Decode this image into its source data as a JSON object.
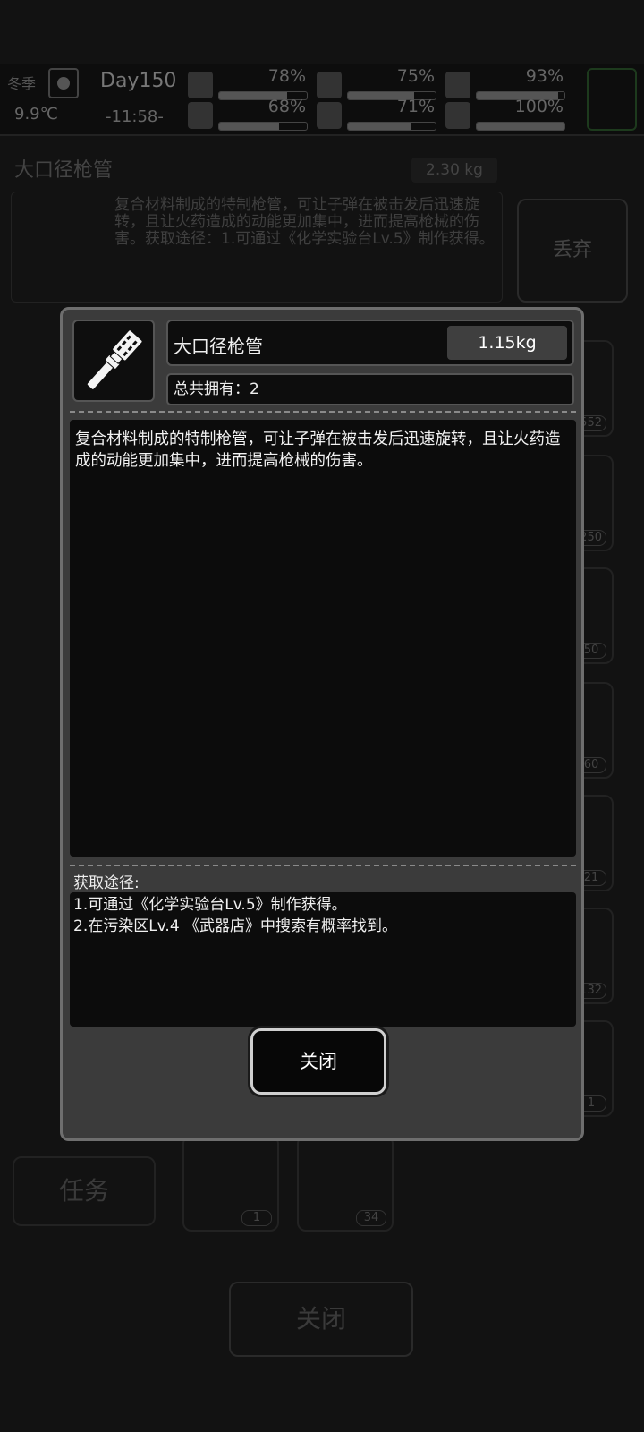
{
  "status": {
    "season": "冬季",
    "temperature": "9.9℃",
    "day": "Day150",
    "time": "-11:58-",
    "stats": [
      {
        "icon": "medkit-icon",
        "value": "78%",
        "fill": 0.78
      },
      {
        "icon": "stomach-icon",
        "value": "75%",
        "fill": 0.75
      },
      {
        "icon": "pill-icon",
        "value": "93%",
        "fill": 0.93
      },
      {
        "icon": "boot-icon",
        "value": "68%",
        "fill": 0.68
      },
      {
        "icon": "water-drop-icon",
        "value": "71%",
        "fill": 0.71
      },
      {
        "icon": "heart-icon",
        "value": "100%",
        "fill": 1.0
      }
    ]
  },
  "background": {
    "item_title": "大口径枪管",
    "item_weight": "2.30 kg",
    "item_desc": "复合材料制成的特制枪管，可让子弹在被击发后迅速旋转，且让火药造成的动能更加集中，进而提高枪械的伤害。获取途径：1.可通过《化学实验台Lv.5》制作获得。",
    "discard_label": "丢弃",
    "task_label": "任务",
    "close_label": "关闭",
    "slot_counts": [
      "552",
      "250",
      "50",
      "60",
      "21",
      "132",
      "1",
      "1",
      "34"
    ]
  },
  "modal": {
    "title": "大口径枪管",
    "weight": "1.15kg",
    "owned": "总共拥有：2",
    "description": "复合材料制成的特制枪管，可让子弹在被击发后迅速旋转，且让火药造成的动能更加集中，进而提高枪械的伤害。",
    "source_label": "获取途径:",
    "sources": [
      "1.可通过《化学实验台Lv.5》制作获得。",
      "2.在污染区Lv.4 《武器店》中搜索有概率找到。"
    ],
    "close_label": "关闭"
  }
}
